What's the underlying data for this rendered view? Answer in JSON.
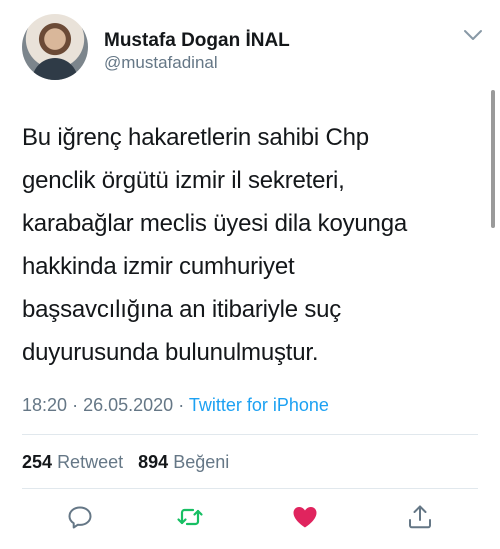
{
  "tweet": {
    "display_name": "Mustafa Dogan İNAL",
    "handle": "@mustafadinal",
    "text": "Bu iğrenç hakaretlerin sahibi Chp\ngenclik örgütü izmir il sekreteri,\nkarabağlar meclis üyesi dila koyunga\nhakkinda izmir cumhuriyet\nbaşsavcılığına an itibariyle suç\nduyurusunda bulunulmuştur.",
    "time": "18:20",
    "separator": "·",
    "date": "26.05.2020",
    "source": "Twitter for iPhone"
  },
  "stats": {
    "retweet_count": "254",
    "retweet_label": "Retweet",
    "like_count": "894",
    "like_label": "Beğeni"
  },
  "colors": {
    "text": "#14171a",
    "secondary": "#657786",
    "link": "#1da1f2",
    "retweet_green": "#17bf63",
    "like_red": "#e0245e"
  },
  "icons": {
    "reply": "reply-icon",
    "retweet": "retweet-icon",
    "like": "heart-icon",
    "share": "share-icon",
    "menu": "chevron-down-icon"
  }
}
